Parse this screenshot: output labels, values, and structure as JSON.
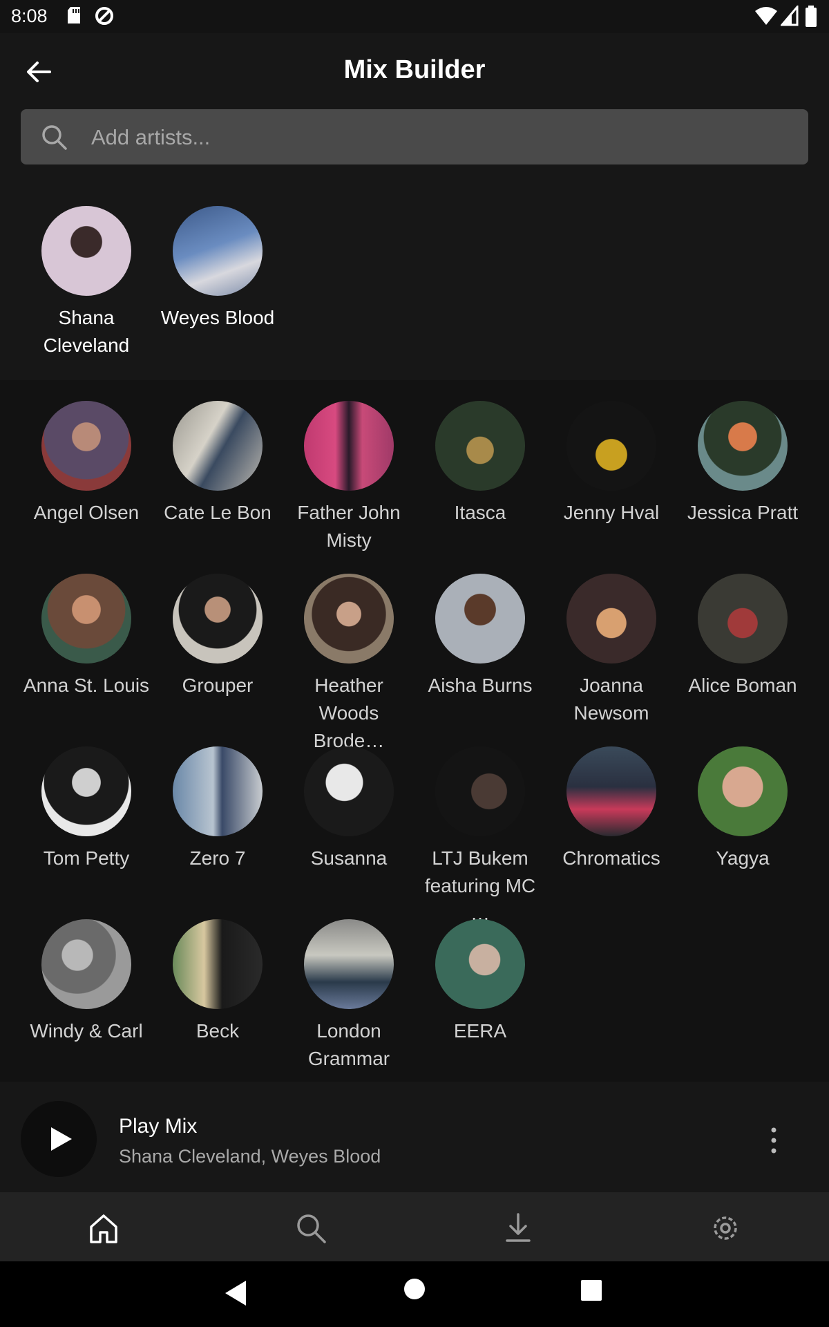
{
  "status_bar": {
    "time": "8:08"
  },
  "header": {
    "title": "Mix Builder"
  },
  "search": {
    "placeholder": "Add artists..."
  },
  "selected_artists": [
    {
      "name": "Shana Cleveland"
    },
    {
      "name": "Weyes Blood"
    }
  ],
  "suggested_artists": [
    {
      "name": "Angel Olsen"
    },
    {
      "name": "Cate Le Bon"
    },
    {
      "name": "Father John Misty"
    },
    {
      "name": "Itasca"
    },
    {
      "name": "Jenny Hval"
    },
    {
      "name": "Jessica Pratt"
    },
    {
      "name": "Anna St. Louis"
    },
    {
      "name": "Grouper"
    },
    {
      "name": "Heather Woods Brode…"
    },
    {
      "name": "Aisha Burns"
    },
    {
      "name": "Joanna Newsom"
    },
    {
      "name": "Alice Boman"
    },
    {
      "name": "Tom Petty"
    },
    {
      "name": "Zero 7"
    },
    {
      "name": "Susanna"
    },
    {
      "name": "LTJ Bukem featuring MC …"
    },
    {
      "name": "Chromatics"
    },
    {
      "name": "Yagya"
    },
    {
      "name": "Windy & Carl"
    },
    {
      "name": "Beck"
    },
    {
      "name": "London Grammar"
    },
    {
      "name": "EERA"
    }
  ],
  "player": {
    "title": "Play Mix",
    "subtitle": "Shana Cleveland, Weyes Blood"
  },
  "bottom_nav": [
    {
      "icon": "home-icon"
    },
    {
      "icon": "search-icon"
    },
    {
      "icon": "download-icon"
    },
    {
      "icon": "settings-icon"
    }
  ],
  "colors": {
    "background": "#171717",
    "suggest_background": "#121212",
    "search_field": "#4a4a4a",
    "nav_background": "#232323"
  }
}
